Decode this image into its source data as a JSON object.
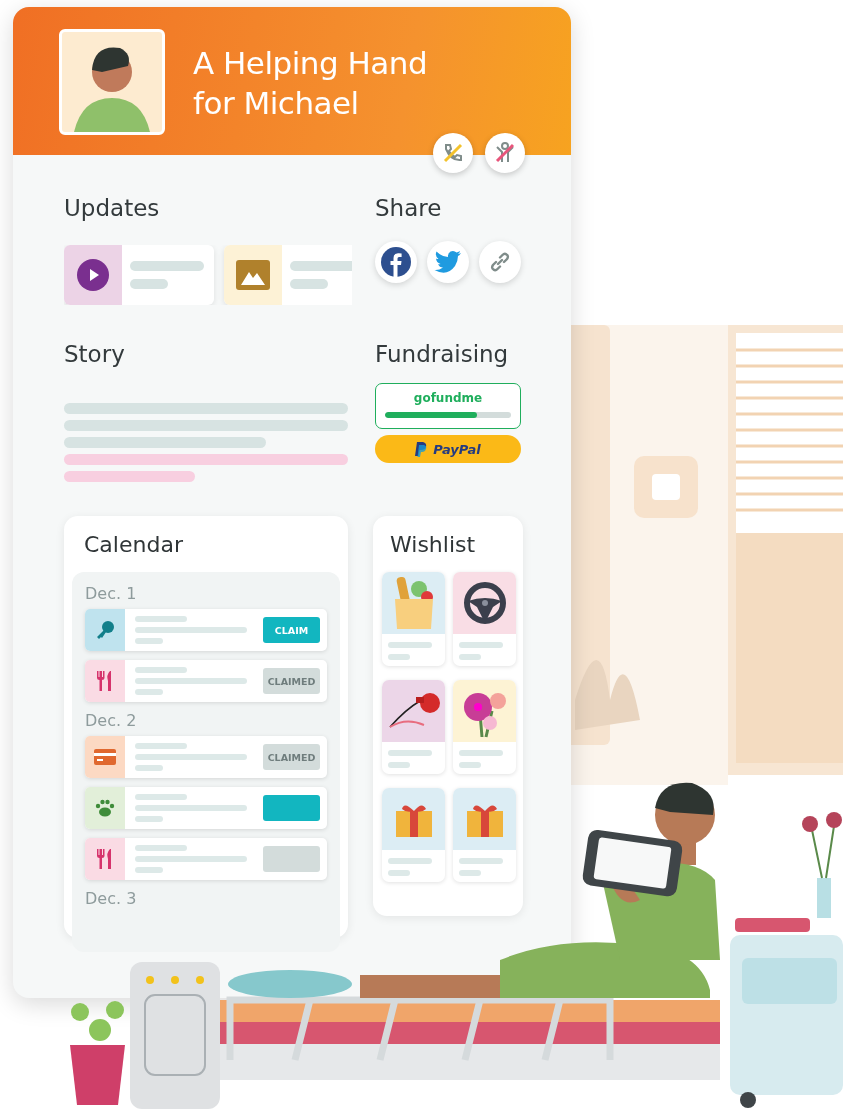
{
  "header": {
    "title_lines": [
      "A Helping Hand",
      "for Michael"
    ],
    "badges": [
      {
        "kind": "no-calls"
      },
      {
        "kind": "no-visitors"
      }
    ]
  },
  "updates": {
    "title": "Updates",
    "items": [
      {
        "kind": "video",
        "color": "#ecd3e6"
      },
      {
        "kind": "photo",
        "color": "#fdf2d6"
      }
    ]
  },
  "share": {
    "title": "Share",
    "items": [
      {
        "kind": "facebook"
      },
      {
        "kind": "twitter"
      },
      {
        "kind": "link"
      }
    ]
  },
  "story": {
    "title": "Story"
  },
  "fundraising": {
    "title": "Fundraising",
    "gofundme": {
      "label": "gofundme",
      "level": 0.73
    },
    "paypal": {
      "label": "PayPal"
    }
  },
  "calendar": {
    "title": "Calendar",
    "days": [
      {
        "label": "Dec. 1",
        "items": [
          {
            "kind": "key",
            "color": "#bfe3ee",
            "button": "CLAIM",
            "claimed": false
          },
          {
            "kind": "meal",
            "color": "#fadbe4",
            "button": "CLAIMED",
            "claimed": true
          }
        ]
      },
      {
        "label": "Dec. 2",
        "items": [
          {
            "kind": "card",
            "color": "#fcd9c3",
            "button": "CLAIMED",
            "claimed": true
          },
          {
            "kind": "paw",
            "color": "#e2efd9",
            "claimed": false
          },
          {
            "kind": "meal",
            "color": "#fadbe4",
            "claimed": true
          }
        ]
      },
      {
        "label": "Dec. 3"
      }
    ]
  },
  "wishlist": {
    "title": "Wishlist",
    "items": [
      {
        "kind": "groceries",
        "color": "#dcedf4"
      },
      {
        "kind": "wheel",
        "color": "#f9dde5"
      },
      {
        "kind": "leash",
        "color": "#ecd6e8"
      },
      {
        "kind": "flowers",
        "color": "#fdf3d4"
      },
      {
        "kind": "gift",
        "color": "#dcedf4"
      },
      {
        "kind": "gift",
        "color": "#dcedf4"
      }
    ]
  }
}
